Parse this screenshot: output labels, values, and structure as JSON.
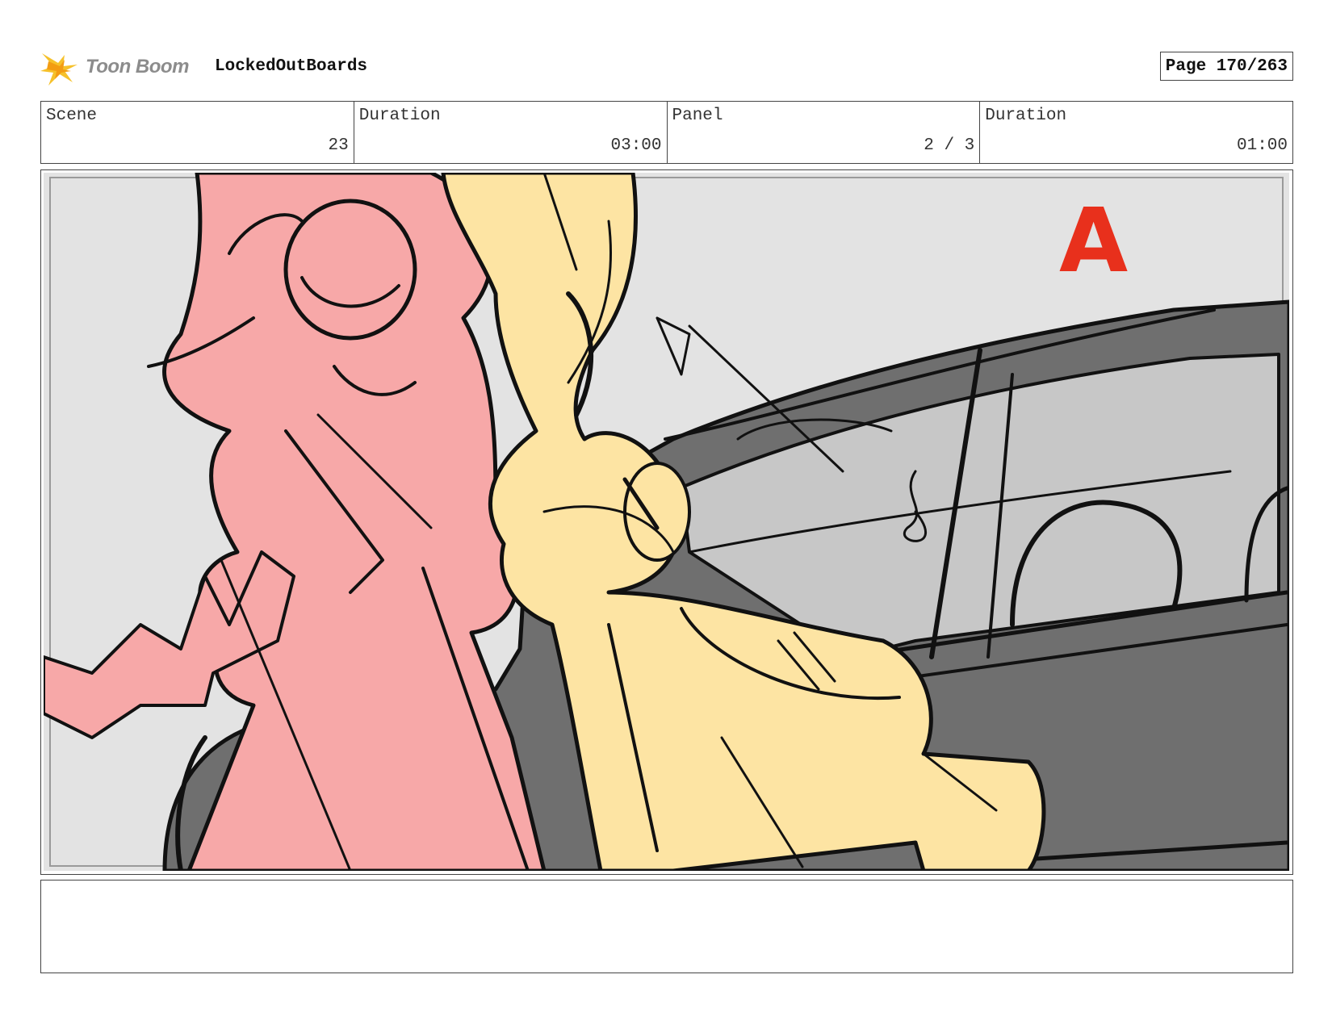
{
  "header": {
    "logo_text": "Toon Boom",
    "project_name": "LockedOutBoards",
    "page_label": "Page 170/263"
  },
  "info": {
    "scene_label": "Scene",
    "scene_value": "23",
    "scene_duration_label": "Duration",
    "scene_duration_value": "03:00",
    "panel_label": "Panel",
    "panel_value": "2 / 3",
    "panel_duration_label": "Duration",
    "panel_duration_value": "01:00"
  },
  "panel": {
    "corner_mark": "A"
  },
  "notes": {
    "text": ""
  },
  "colors": {
    "pink_character": "#f7a8a8",
    "yellow_character": "#fde4a3",
    "car_dark": "#6f6f6f",
    "car_window": "#c7c7c7",
    "background": "#e3e3e3",
    "mark_red": "#e8301c"
  }
}
